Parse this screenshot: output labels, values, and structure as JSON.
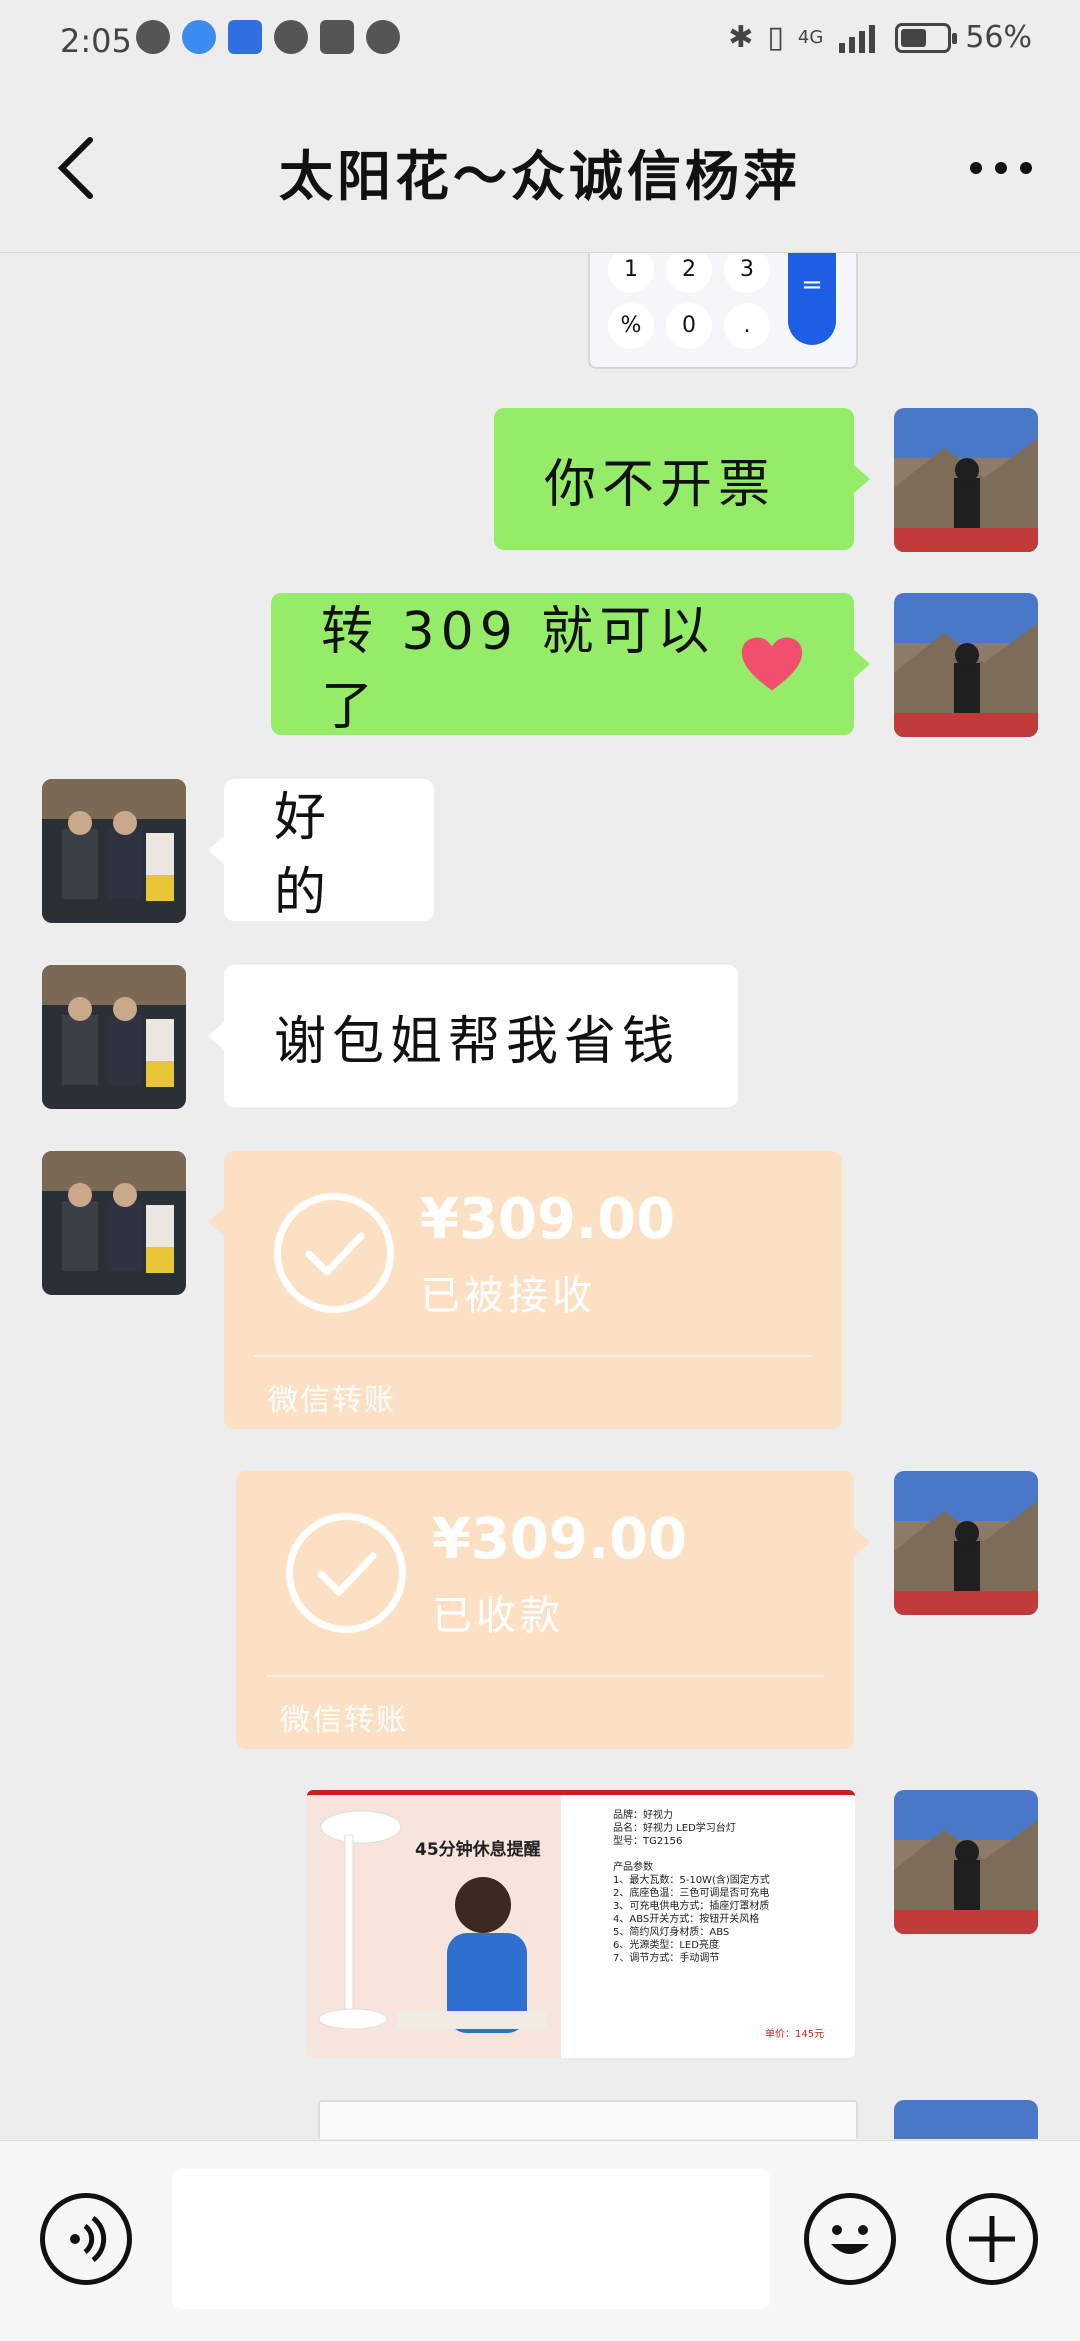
{
  "status_bar": {
    "time": "2:05",
    "battery_percent": "56%",
    "battery_level": 0.56,
    "network": "4G"
  },
  "header": {
    "title": "太阳花～众诚信杨萍"
  },
  "messages": {
    "msg1": "你不开票",
    "msg2_text": "转 309 就可以了",
    "msg3": "好的",
    "msg4": "谢包姐帮我省钱"
  },
  "transfer_received_by_them": {
    "amount": "¥309.00",
    "status": "已被接收",
    "footer": "微信转账"
  },
  "transfer_received_by_me": {
    "amount": "¥309.00",
    "status": "已收款",
    "footer": "微信转账"
  },
  "product_image": {
    "headline": "45分钟休息提醒",
    "specs": "品牌：好视力\n品名：好视力 LED学习台灯\n型号：TG2156\n\n产品参数\n1、最大瓦数：5-10W(含)固定方式\n2、底座色温：三色可调是否可充电\n3、可充电供电方式：插座灯罩材质\n4、ABS开关方式：按钮开关风格\n5、简约风灯身材质：ABS\n6、光源类型：LED亮度\n7、调节方式：手动调节",
    "price": "单价：145元"
  },
  "calculator_keys": [
    "1",
    "2",
    "3",
    "%",
    "0",
    ".",
    "="
  ],
  "colors": {
    "my_bubble": "#95ec69",
    "other_bubble": "#ffffff",
    "transfer_card": "#fce0c4",
    "background": "#ededed"
  },
  "icons": {
    "back": "chevron-left-icon",
    "more": "ellipsis-icon",
    "voice": "voice-icon",
    "emoji": "emoji-icon",
    "add": "plus-icon",
    "heart": "heart-emoji"
  }
}
